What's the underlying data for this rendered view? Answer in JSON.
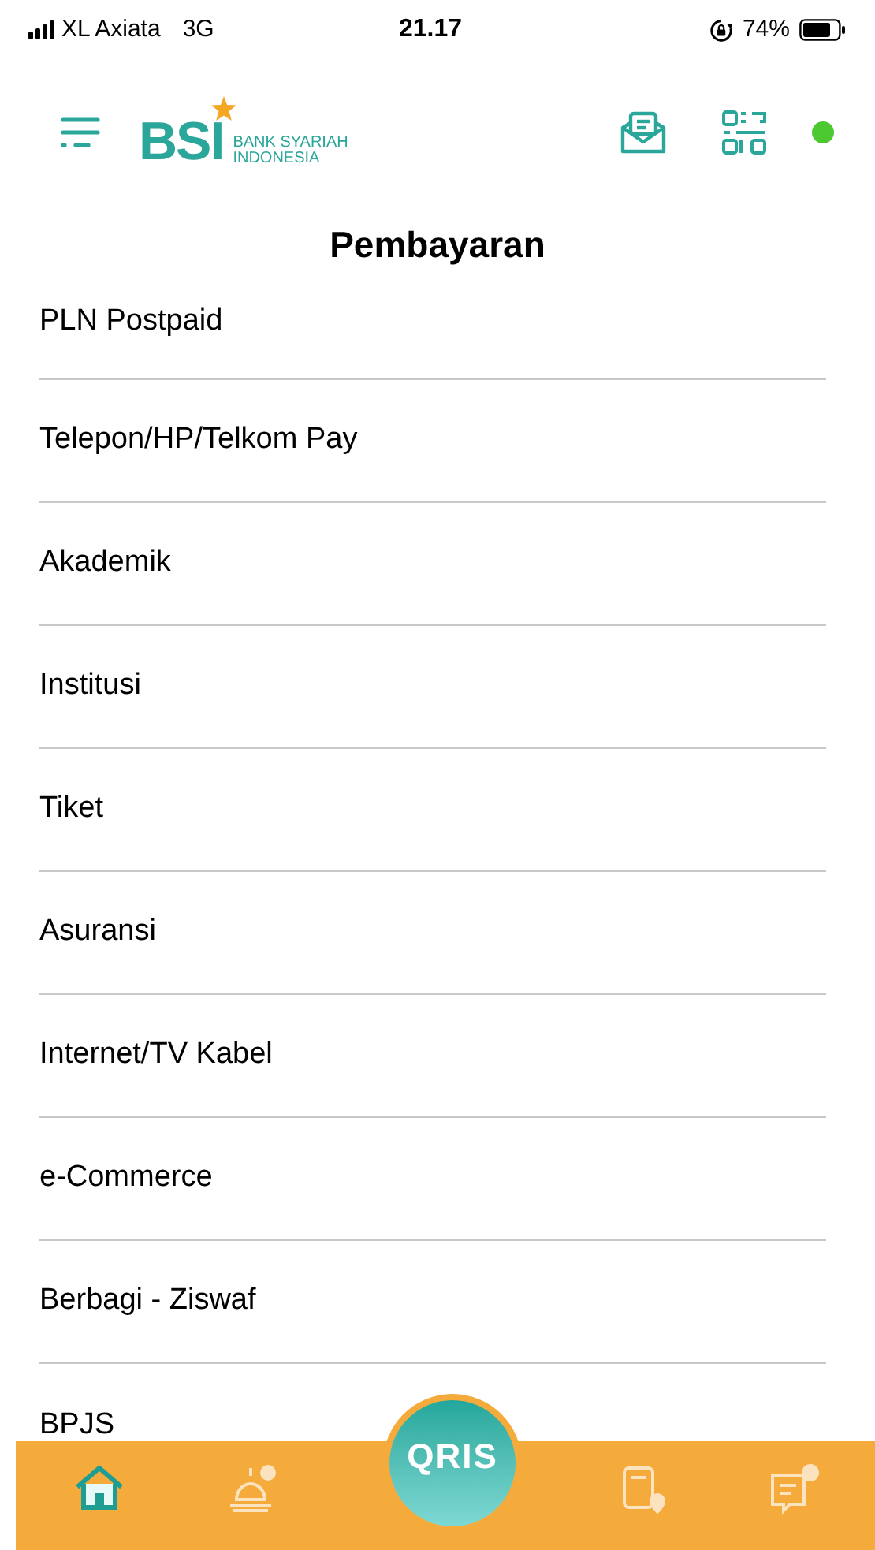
{
  "status_bar": {
    "carrier": "XL Axiata",
    "network": "3G",
    "time": "21.17",
    "battery": "74%"
  },
  "header": {
    "logo": "BSI",
    "logo_subtitle": [
      "BANK SYARIAH",
      "INDONESIA"
    ],
    "online": true
  },
  "title": "Pembayaran",
  "items": [
    {
      "label": "PLN Postpaid"
    },
    {
      "label": "Telepon/HP/Telkom Pay"
    },
    {
      "label": "Akademik"
    },
    {
      "label": "Institusi"
    },
    {
      "label": "Tiket"
    },
    {
      "label": "Asuransi"
    },
    {
      "label": "Internet/TV Kabel"
    },
    {
      "label": "e-Commerce"
    },
    {
      "label": "Berbagi - Ziswaf"
    },
    {
      "label": "BPJS"
    }
  ],
  "bottom_nav": {
    "qris": "QRIS",
    "items": [
      {
        "kind": "home",
        "selected": true
      },
      {
        "kind": "prayer",
        "selected": false
      },
      {
        "kind": "calculator",
        "selected": false
      },
      {
        "kind": "help",
        "selected": false
      }
    ]
  }
}
